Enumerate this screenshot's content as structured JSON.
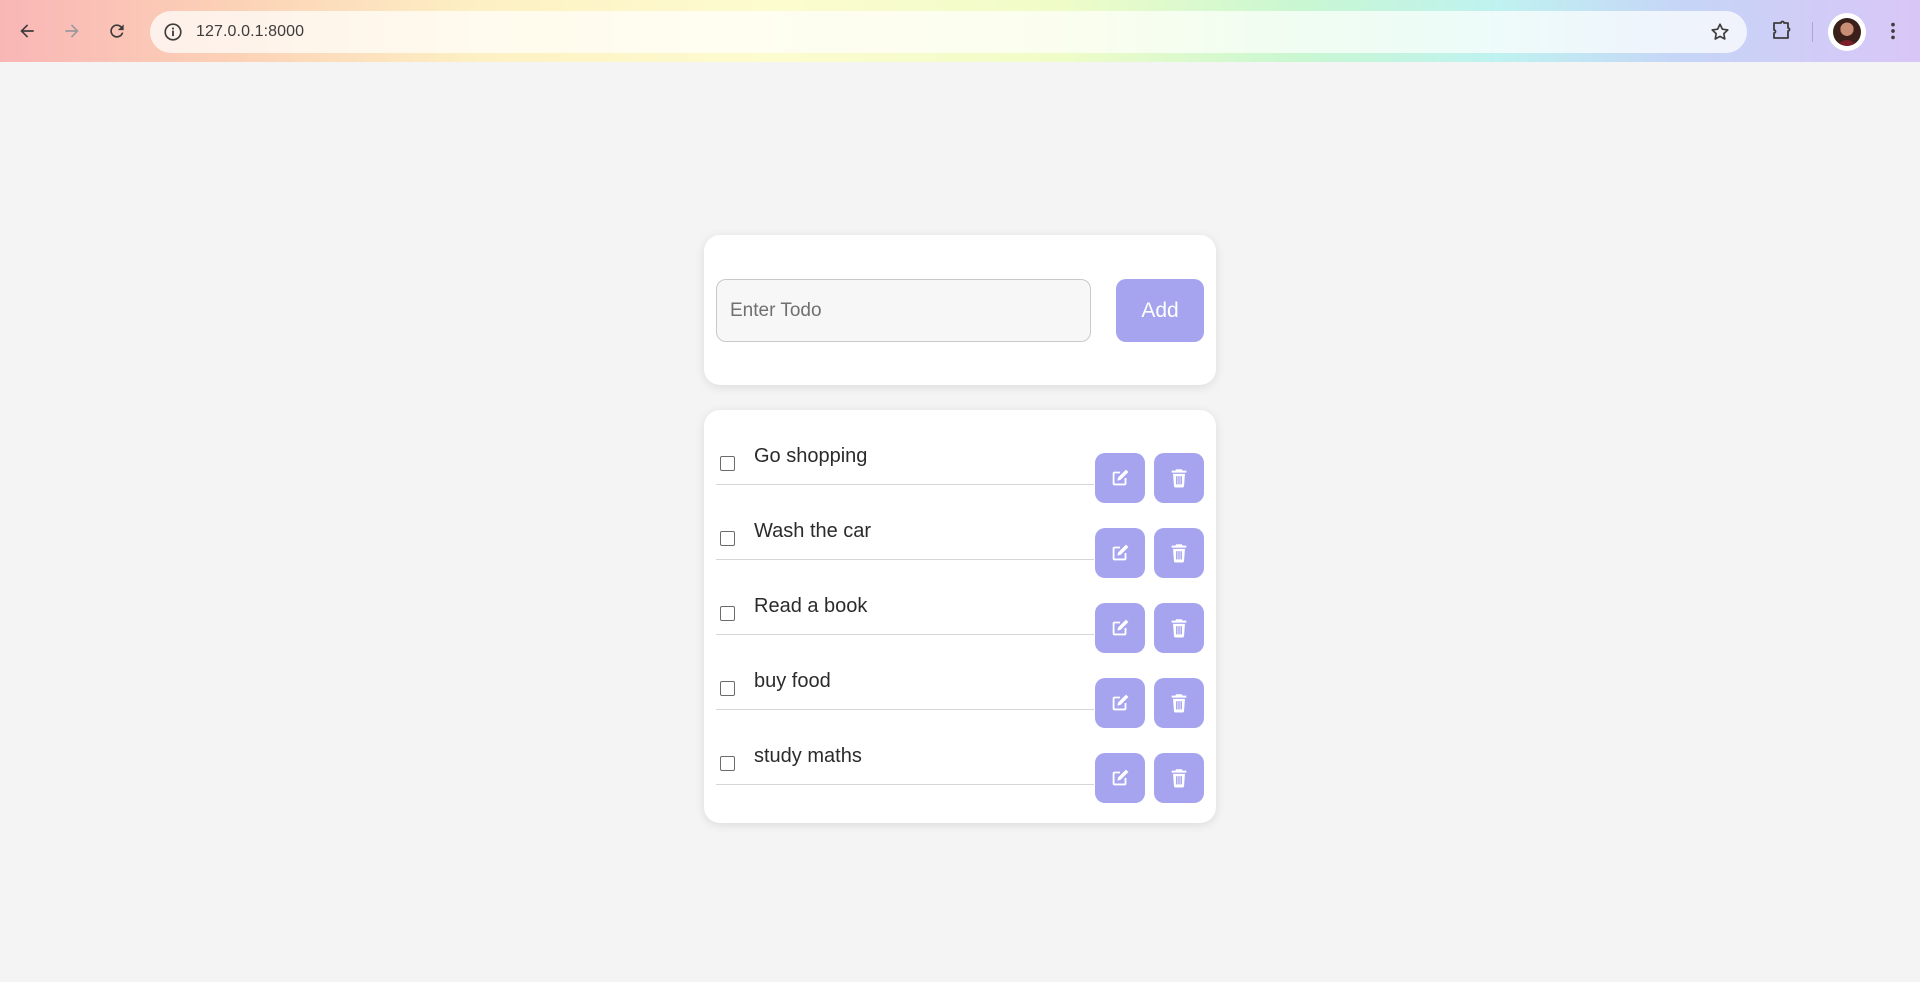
{
  "browser": {
    "url": "127.0.0.1:8000"
  },
  "form": {
    "placeholder": "Enter Todo",
    "add_label": "Add"
  },
  "todos": [
    {
      "text": "Go shopping",
      "checked": false
    },
    {
      "text": "Wash the car",
      "checked": false
    },
    {
      "text": "Read a book",
      "checked": false
    },
    {
      "text": "buy food",
      "checked": false
    },
    {
      "text": "study maths",
      "checked": false
    }
  ],
  "colors": {
    "accent": "#a6a3ef",
    "page_bg": "#f4f4f4"
  },
  "icons": {
    "edit": "edit-icon",
    "delete": "trash-icon"
  }
}
